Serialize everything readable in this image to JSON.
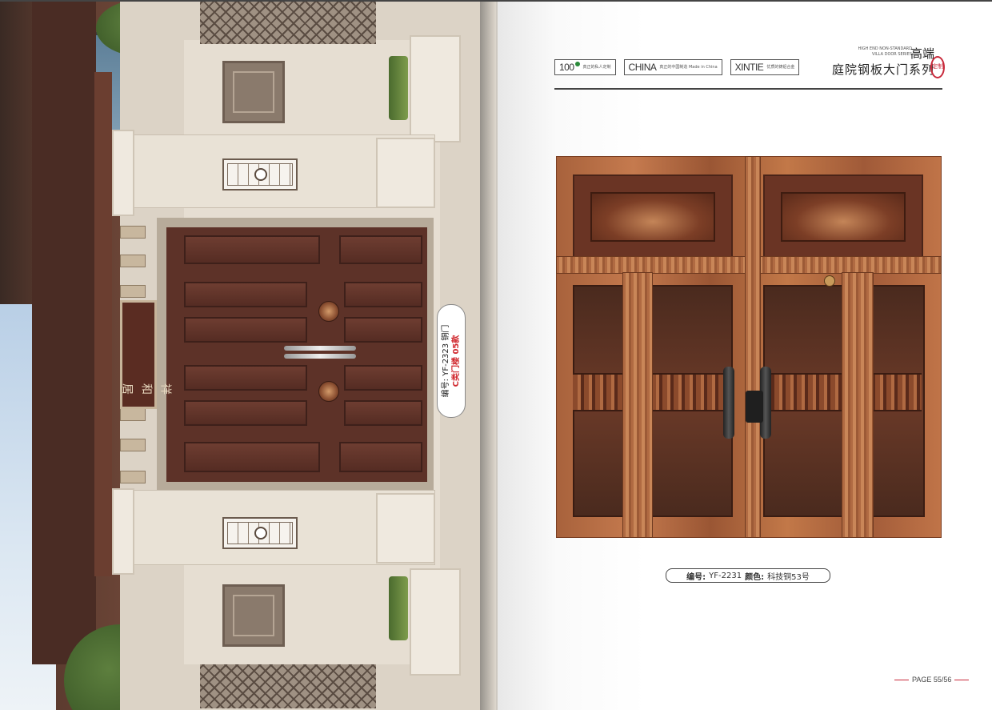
{
  "left_page": {
    "gate_sign_text": "祥和居",
    "label": {
      "line1": "编号: YF-2323 铜门",
      "line2": "C类门楼 05款"
    }
  },
  "right_page": {
    "badges": [
      {
        "big": "100",
        "small": "真正的私人定制",
        "icon": "green-dot-icon"
      },
      {
        "big": "CHINA",
        "small": "真正的中国制造 Made in China",
        "icon": ""
      },
      {
        "big": "XINTIE",
        "small": "优质的铸铝合金",
        "icon": ""
      }
    ],
    "series": {
      "en_line1": "HIGH END NON-STANDARD",
      "en_line2": "VILLA DOOR SERIES",
      "gao_duan": "高端",
      "title": "庭院钢板大门系列",
      "seal": "定制"
    },
    "caption": {
      "code_label": "编号:",
      "code_value": "YF-2231",
      "color_label": "颜色:",
      "color_value": "科技铜53号"
    },
    "page_number": "PAGE 55/56"
  },
  "colors": {
    "accent_red": "#c8283a",
    "copper": "#b06a42",
    "door_brown": "#5d3228"
  }
}
